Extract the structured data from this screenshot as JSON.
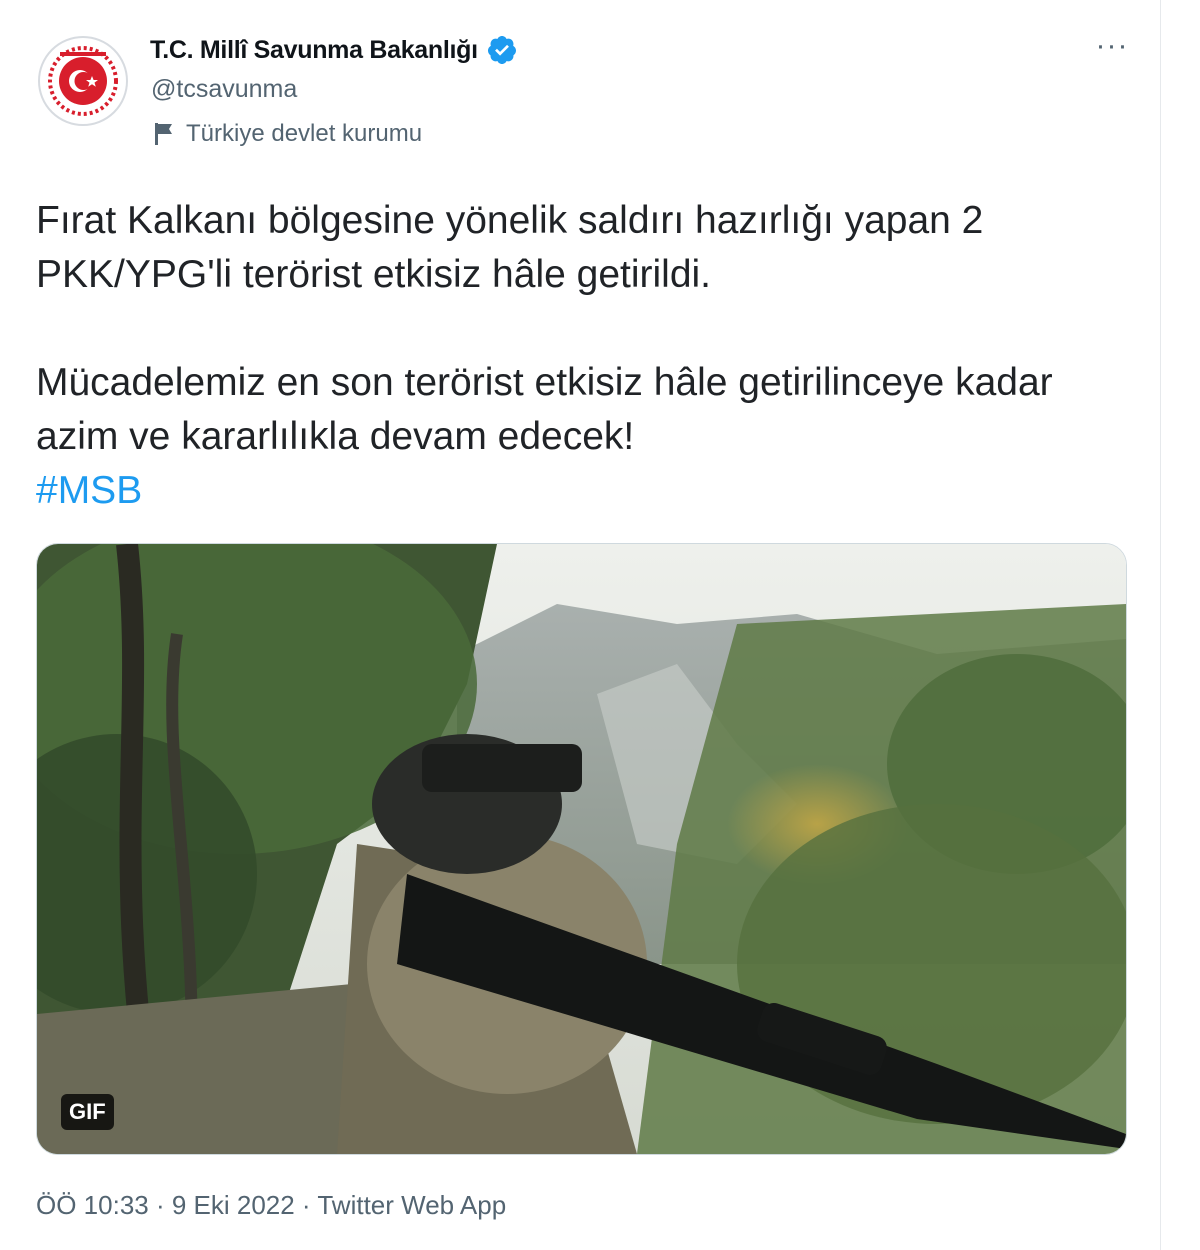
{
  "tweet": {
    "author_name": "T.C. Millî Savunma Bakanlığı",
    "handle": "@tcsavunma",
    "affiliation": "Türkiye devlet kurumu",
    "more_label": "···",
    "paragraph1": "Fırat Kalkanı bölgesine yönelik saldırı hazırlığı yapan 2 PKK/YPG'li terörist etkisiz hâle getirildi.",
    "paragraph2": "Mücadelemiz en son terörist etkisiz hâle getirilinceye kadar azim ve kararlılıkla devam edecek!",
    "hashtag": "#MSB",
    "media_badge": "GIF",
    "timestamp": "ÖÖ 10:33 · 9 Eki 2022 · Twitter Web App"
  },
  "colors": {
    "link": "#1d9bf0",
    "verified": "#1d9bf0",
    "logo_red": "#d81e2c",
    "secondary_text": "#536471"
  },
  "icons": {
    "verified": "verified-badge-icon",
    "affiliation": "flag-icon",
    "more": "more-options-icon",
    "avatar": "ministry-emblem-logo"
  }
}
